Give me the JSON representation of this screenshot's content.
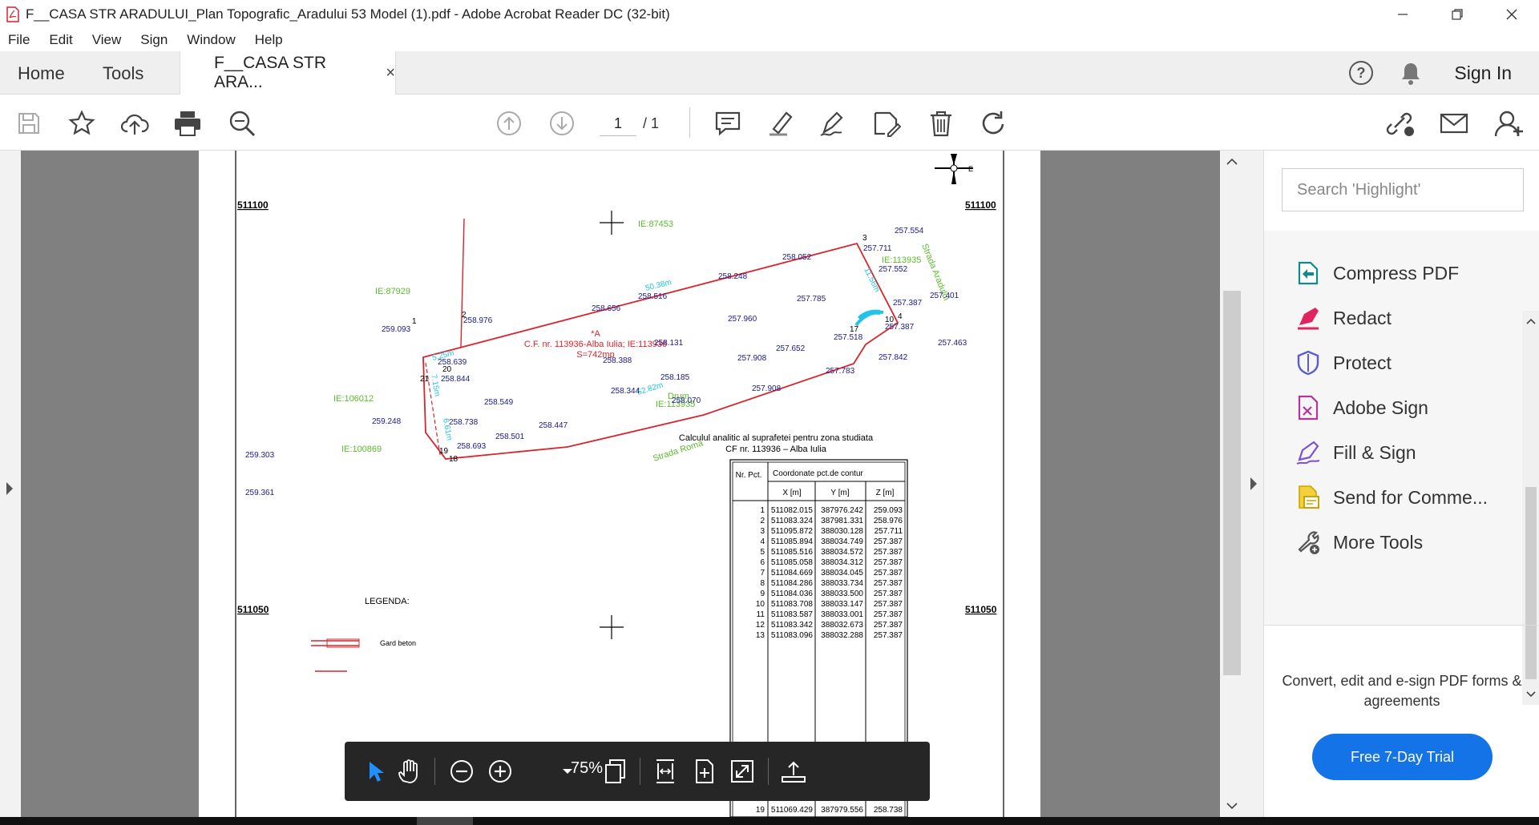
{
  "window": {
    "title": "F__CASA STR ARADULUI_Plan Topografic_Aradului 53 Model (1).pdf - Adobe Acrobat Reader DC (32-bit)"
  },
  "menu": [
    "File",
    "Edit",
    "View",
    "Sign",
    "Window",
    "Help"
  ],
  "tabs": {
    "home": "Home",
    "tools": "Tools",
    "document": "F__CASA STR ARA...",
    "close": "×",
    "sign_in": "Sign In"
  },
  "toolbar": {
    "current_page": "1",
    "total_pages": "/ 1"
  },
  "document": {
    "grid_labels": {
      "top_left": "511100",
      "top_right": "511100",
      "mid_left": "511050",
      "mid_right": "511050"
    },
    "ie_labels": [
      "IE:87453",
      "IE:87929",
      "IE:106012",
      "IE:100869",
      "IE:113935",
      "IE:113935"
    ],
    "street_labels": [
      "Strada Aradului",
      "Strada Roma",
      "Drum"
    ],
    "parcel_label": [
      "*A",
      "C.F. nr. 113936-Alba Iulia; IE:113936",
      "S=742mp"
    ],
    "lengths": [
      "5.25m",
      "50.38m",
      "11.56m",
      "52.82m",
      "7.15m",
      "6.61m"
    ],
    "elevations": [
      "257.554",
      "257.711",
      "257.552",
      "257.401",
      "257.387",
      "257.387",
      "258.052",
      "258.248",
      "258.516",
      "258.656",
      "258.976",
      "259.093",
      "257.785",
      "257.960",
      "258.131",
      "257.518",
      "257.652",
      "257.908",
      "257.842",
      "257.463",
      "257.783",
      "258.639",
      "258.388",
      "258.844",
      "258.185",
      "258.344",
      "258.549",
      "258.070",
      "257.908",
      "259.248",
      "258.738",
      "258.501",
      "258.447",
      "258.693",
      "259.303",
      "259.361"
    ],
    "point_numbers": [
      "1",
      "2",
      "3",
      "4",
      "10",
      "17",
      "18",
      "19",
      "20",
      "21"
    ],
    "legend_title": "LEGENDA:",
    "legend_item": "Gard beton",
    "table_title": [
      "Calculul analitic al suprafetei pentru zona studiata",
      "CF nr. 113936 – Alba Iulia"
    ],
    "table_headers": {
      "nr": "Nr. Pct.",
      "coords": "Coordonate pct.de contur",
      "x": "X [m]",
      "y": "Y [m]",
      "z": "Z [m]"
    },
    "table_rows": [
      [
        "1",
        "511082.015",
        "387976.242",
        "259.093"
      ],
      [
        "2",
        "511083.324",
        "387981.331",
        "258.976"
      ],
      [
        "3",
        "511095.872",
        "388030.128",
        "257.711"
      ],
      [
        "4",
        "511085.894",
        "388034.749",
        "257.387"
      ],
      [
        "5",
        "511085.516",
        "388034.572",
        "257.387"
      ],
      [
        "6",
        "511085.058",
        "388034.312",
        "257.387"
      ],
      [
        "7",
        "511084.669",
        "388034.045",
        "257.387"
      ],
      [
        "8",
        "511084.286",
        "388033.734",
        "257.387"
      ],
      [
        "9",
        "511084.036",
        "388033.500",
        "257.387"
      ],
      [
        "10",
        "511083.708",
        "388033.147",
        "257.387"
      ],
      [
        "11",
        "511083.587",
        "388033.001",
        "257.387"
      ],
      [
        "12",
        "511083.342",
        "388032.673",
        "257.387"
      ],
      [
        "13",
        "511083.096",
        "388032.288",
        "257.387"
      ]
    ],
    "table_last_row": [
      "19",
      "511069.429",
      "387979.556",
      "258.738"
    ]
  },
  "float_toolbar": {
    "zoom": "75%"
  },
  "panel": {
    "search_placeholder": "Search 'Highlight'",
    "tools": [
      "Compress PDF",
      "Redact",
      "Protect",
      "Adobe Sign",
      "Fill & Sign",
      "Send for Comme...",
      "More Tools"
    ],
    "promo": "Convert, edit and e-sign PDF forms & agreements",
    "trial_button": "Free 7-Day Trial"
  },
  "colors": {
    "accent": "#1473e6",
    "parcel_red": "#d9242b",
    "label_green": "#5dbb2e",
    "label_blue": "#1a1a8c",
    "dim_cyan": "#22c3e6"
  }
}
